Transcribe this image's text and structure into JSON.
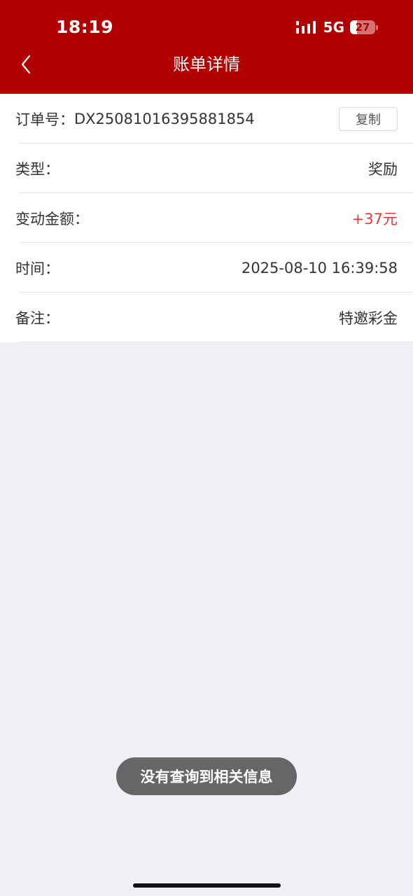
{
  "status_bar": {
    "time": "18:19",
    "network": "5G",
    "battery": "27",
    "battery_level": 0.27
  },
  "header": {
    "title": "账单详情",
    "back_icon": "chevron-left-icon"
  },
  "colors": {
    "header_bg": "#b00000",
    "amount": "#e53935",
    "page_bg": "#f0f0f4"
  },
  "details": {
    "order_label": "订单号：",
    "order_value": "DX25081016395881854",
    "copy_label": "复制",
    "type_label": "类型：",
    "type_value": "奖励",
    "amount_label": "变动金额：",
    "amount_value": "+37元",
    "time_label": "时间：",
    "time_value": "2025-08-10 16:39:58",
    "remark_label": "备注：",
    "remark_value": "特邀彩金"
  },
  "toast": {
    "message": "没有查询到相关信息"
  }
}
